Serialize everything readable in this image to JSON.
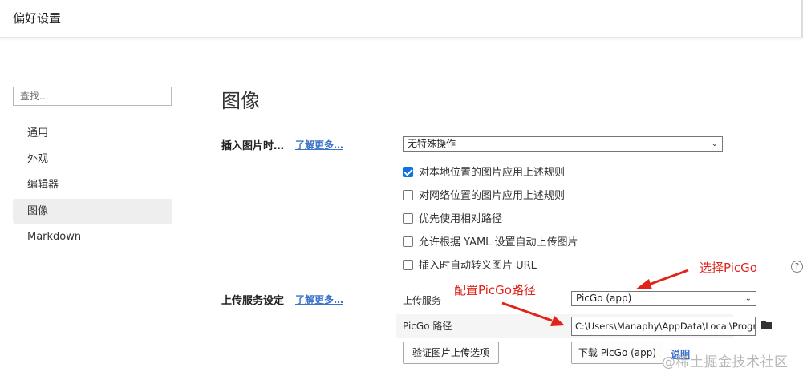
{
  "window": {
    "title": "偏好设置"
  },
  "sidebar": {
    "search_placeholder": "查找...",
    "items": [
      {
        "label": "通用"
      },
      {
        "label": "外观"
      },
      {
        "label": "编辑器"
      },
      {
        "label": "图像",
        "active": true
      },
      {
        "label": "Markdown"
      }
    ]
  },
  "main": {
    "title": "图像",
    "insert_image": {
      "label": "插入图片时…",
      "learn_more": "了解更多…",
      "select_value": "无特殊操作",
      "options": [
        {
          "label": "对本地位置的图片应用上述规则",
          "checked": true
        },
        {
          "label": "对网络位置的图片应用上述规则",
          "checked": false
        },
        {
          "label": "优先使用相对路径",
          "checked": false
        },
        {
          "label": "允许根据 YAML 设置自动上传图片",
          "checked": false
        },
        {
          "label": "插入时自动转义图片 URL",
          "checked": false
        }
      ]
    },
    "upload": {
      "label": "上传服务设定",
      "learn_more": "了解更多…",
      "service_label": "上传服务",
      "service_value": "PicGo (app)",
      "path_label": "PicGo 路径",
      "path_value": "C:\\Users\\Manaphy\\AppData\\Local\\Programs",
      "verify_button": "验证图片上传选项",
      "download_button": "下载 PicGo (app)",
      "doc_link": "说明"
    },
    "help_icon": "?"
  },
  "annotations": {
    "select_picgo": "选择PicGo",
    "config_path": "配置PicGo路径",
    "color": "#e2231a"
  },
  "watermark": "@稀土掘金技术社区",
  "colors": {
    "accent": "#0b74de",
    "link": "#3b73c9",
    "active_nav": "#eeeeee"
  }
}
